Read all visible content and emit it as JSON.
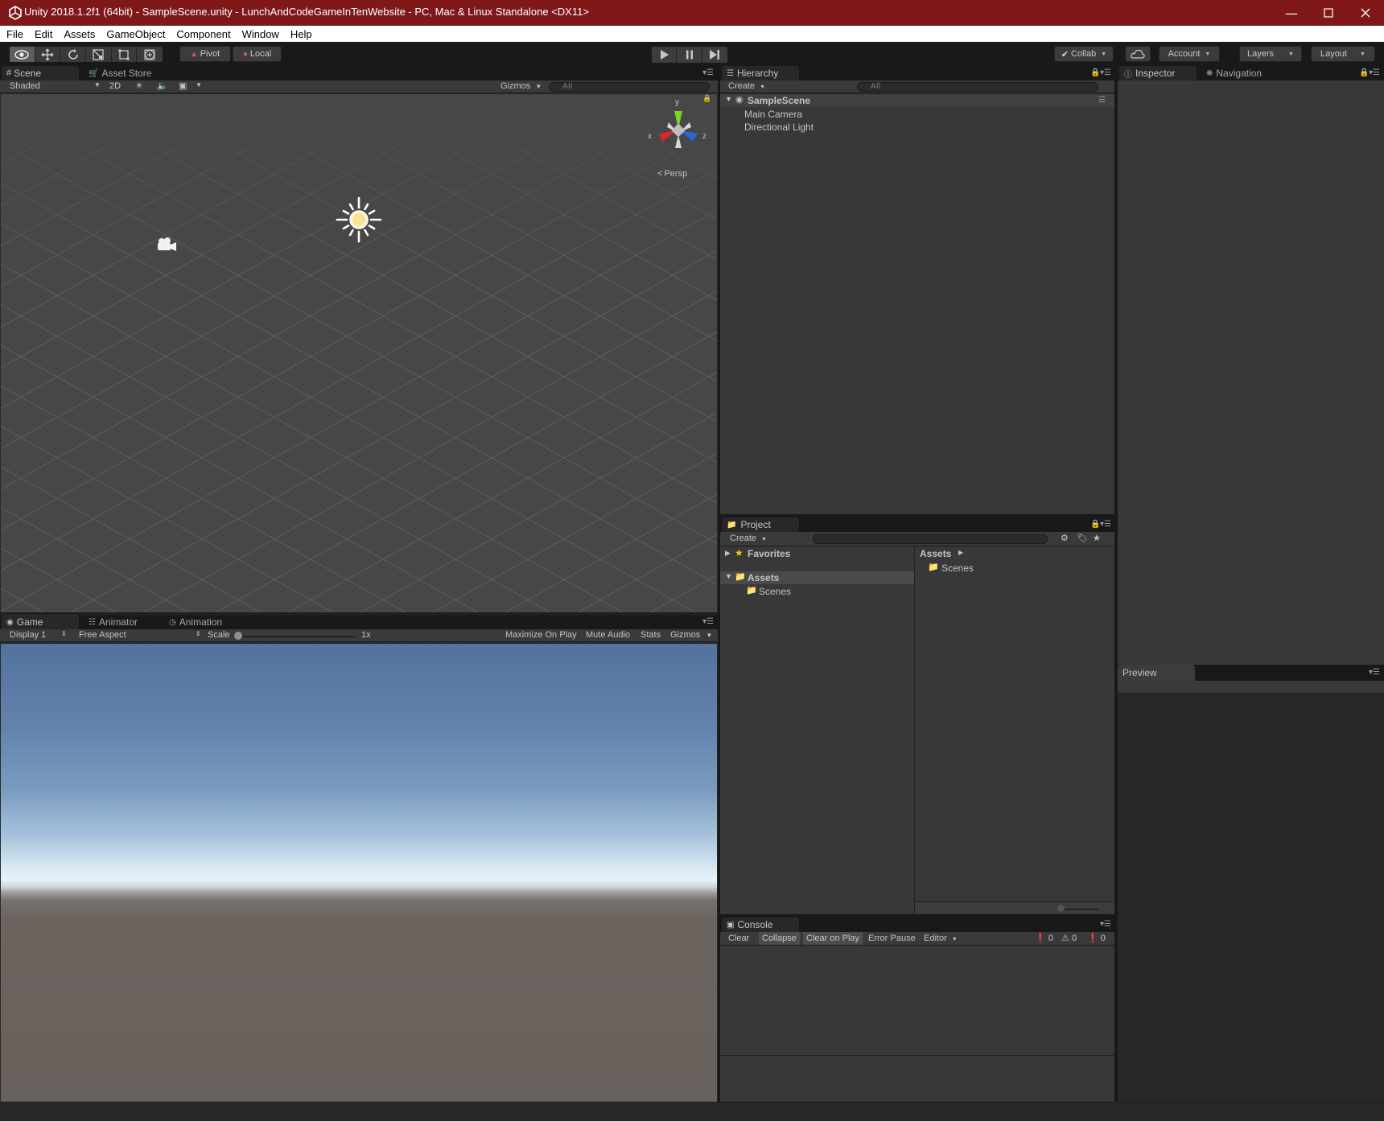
{
  "window": {
    "title": "Unity 2018.1.2f1 (64bit) - SampleScene.unity - LunchAndCodeGameInTenWebsite - PC, Mac & Linux Standalone <DX11>",
    "controls": [
      "minimize-icon",
      "maximize-icon",
      "close-icon"
    ],
    "title_bar_color": "#7f1919"
  },
  "menu": [
    "File",
    "Edit",
    "Assets",
    "GameObject",
    "Component",
    "Window",
    "Help"
  ],
  "toolbar": {
    "tools": [
      "view-tool-icon",
      "move-tool-icon",
      "rotate-tool-icon",
      "scale-tool-icon",
      "rect-tool-icon",
      "transform-tool-icon"
    ],
    "pivot_label": "Pivot",
    "local_label": "Local",
    "play_controls": [
      "play-icon",
      "pause-icon",
      "step-icon"
    ],
    "collab_label": "Collab",
    "account_label": "Account",
    "layers_label": "Layers",
    "layout_label": "Layout"
  },
  "scene": {
    "tabs": [
      "Scene",
      "Asset Store"
    ],
    "shading_mode": "Shaded",
    "mode_2d": "2D",
    "gizmos_label": "Gizmos",
    "search_placeholder": "All",
    "persp_label": "Persp",
    "axis_y": "y",
    "axis_x": "x",
    "axis_z": "z",
    "axis_colors": {
      "x": "#d52a2a",
      "y": "#7ed321",
      "z": "#2a64d5"
    }
  },
  "game": {
    "tabs": [
      "Game",
      "Animator",
      "Animation"
    ],
    "display": "Display 1",
    "aspect": "Free Aspect",
    "scale_label": "Scale",
    "scale_value": "1x",
    "toggles": [
      "Maximize On Play",
      "Mute Audio",
      "Stats",
      "Gizmos"
    ]
  },
  "hierarchy": {
    "tab": "Hierarchy",
    "create_label": "Create",
    "search_placeholder": "All",
    "scene_name": "SampleScene",
    "items": [
      "Main Camera",
      "Directional Light"
    ]
  },
  "project": {
    "tab": "Project",
    "create_label": "Create",
    "favorites_label": "Favorites",
    "assets_label": "Assets",
    "tree_child": "Scenes",
    "breadcrumb": "Assets",
    "folder_items": [
      "Scenes"
    ]
  },
  "console": {
    "tab": "Console",
    "buttons": [
      "Clear",
      "Collapse",
      "Clear on Play",
      "Error Pause",
      "Editor"
    ],
    "error_count": "0",
    "warning_count": "0",
    "log_count": "0"
  },
  "inspector": {
    "tabs": [
      "Inspector",
      "Navigation"
    ],
    "preview_label": "Preview"
  }
}
